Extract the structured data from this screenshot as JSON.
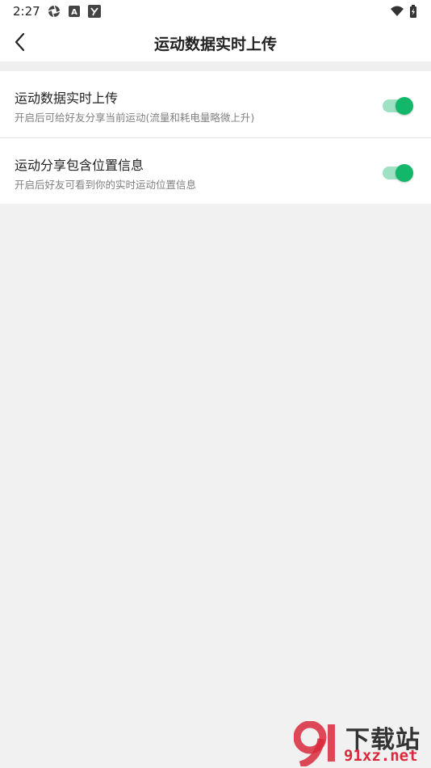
{
  "status_bar": {
    "time": "2:27",
    "icons": [
      "aperture-icon",
      "a-badge-icon",
      "y-badge-icon",
      "wifi-icon",
      "battery-charging-icon"
    ]
  },
  "header": {
    "title": "运动数据实时上传",
    "back_icon": "chevron-left-icon"
  },
  "settings": [
    {
      "title": "运动数据实时上传",
      "subtitle": "开启后可给好友分享当前运动(流量和耗电量略微上升)",
      "enabled": true
    },
    {
      "title": "运动分享包含位置信息",
      "subtitle": "开启后好友可看到你的实时运动位置信息",
      "enabled": true
    }
  ],
  "colors": {
    "accent": "#12b76a",
    "accent_track": "#9fe2c3",
    "background": "#f1f1f1"
  },
  "watermark": {
    "line1": "下载站",
    "line2": "91xz.net"
  }
}
